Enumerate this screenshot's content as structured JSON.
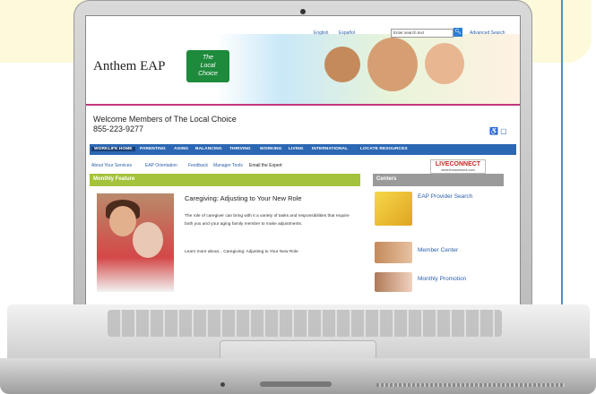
{
  "site": {
    "top_links": [
      "English",
      "Español"
    ],
    "search_placeholder": "Enter search text",
    "search_icon": "search-icon",
    "advanced_search": "Advanced Search",
    "brand": "Anthem EAP",
    "badge_line1": "The",
    "badge_line2": "Local",
    "badge_line3": "Choice",
    "welcome_line1": "Welcome Members of The Local Choice",
    "welcome_line2": "855-223-9277",
    "accessibility": "♿ ▢"
  },
  "nav": {
    "items": [
      "WORKLIFE HOME",
      "PARENTING",
      "AGING",
      "BALANCING",
      "THRIVING",
      "WORKING",
      "LIVING",
      "INTERNATIONAL",
      "LOCATE RESOURCES"
    ]
  },
  "subnav": {
    "items": [
      "About Your Services",
      "EAP Orientation",
      "Feedback",
      "Manager Tools",
      "Email the Expert"
    ]
  },
  "liveconnect": {
    "label": "LIVECONNECT",
    "sub": "www.liveandwork.com"
  },
  "feature": {
    "header": "Monthly Feature",
    "title": "Caregiving: Adjusting to Your New Role",
    "body": "The role of caregiver can bring with it a variety of tasks and responsibilities that require both you and your aging family member to make adjustments.",
    "link": "Learn more about... Caregiving: Adjusting to Your New Role"
  },
  "centers": {
    "header": "Centers",
    "items": [
      "EAP Provider Search",
      "Member Center",
      "Monthly Promotion"
    ]
  },
  "colors": {
    "nav_blue": "#2b67b3",
    "feature_green": "#a4c23b",
    "accent_pink": "#c2367b",
    "background_yellow": "#fbf6cf"
  }
}
